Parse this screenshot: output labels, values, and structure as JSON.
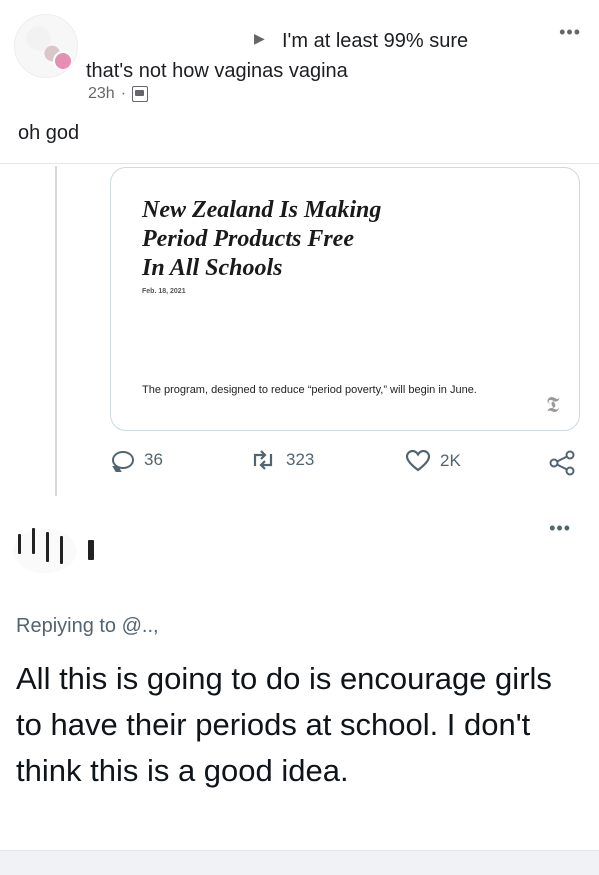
{
  "post": {
    "headline_part1": "I'm at least 99% sure",
    "headline_part2": "that's not how vaginas vagina",
    "time": "23h",
    "separator": "·",
    "more_label": "•••",
    "comment": "oh god"
  },
  "tweet_card": {
    "title_lines": [
      "New Zealand Is Making",
      "Period Products Free",
      "In All Schools"
    ],
    "date": "Feb. 18, 2021",
    "description": "The program, designed to reduce “period poverty,” will begin in June.",
    "publisher_logo": "𝕿"
  },
  "tweet_actions": {
    "replies": "36",
    "retweets": "323",
    "likes": "2K"
  },
  "reply_tweet": {
    "replying_to": "Repiying to @..,",
    "more_label": "•••",
    "text": "All this is going to do is encourage girls to have their periods at school. I don't think this is a good idea."
  },
  "icons": {
    "reply": "reply-bubble-icon",
    "retweet": "retweet-icon",
    "like": "heart-icon",
    "share": "share-icon",
    "audience": "friends-icon"
  },
  "colors": {
    "text": "#1c1e21",
    "muted": "#536471",
    "card_border": "#cfd9de",
    "badge": "#e58fb3"
  }
}
